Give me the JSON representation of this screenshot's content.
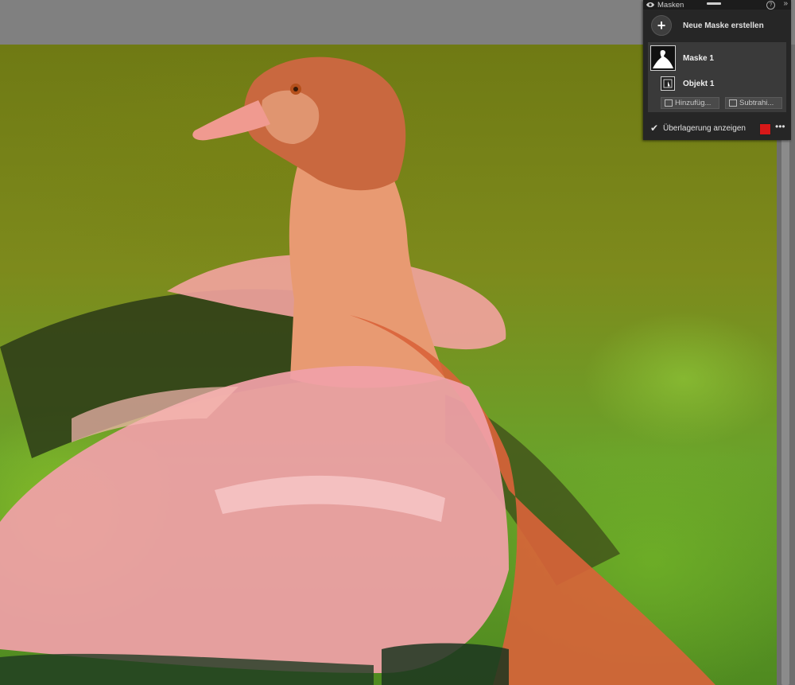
{
  "panel": {
    "title": "Masken",
    "new_mask_label": "Neue Maske erstellen",
    "mask_name": "Maske 1",
    "object_name": "Objekt 1",
    "add_button": "Hinzufüg...",
    "subtract_button": "Subtrahi...",
    "overlay_label": "Überlagerung anzeigen",
    "overlay_checked": true,
    "overlay_color": "#d81818",
    "icons": {
      "eye": "eye-icon",
      "help": "help-icon",
      "collapse": "double-chevron-right-icon",
      "plus": "plus-icon",
      "more": "more-icon",
      "check": "checkmark-icon"
    }
  },
  "colors": {
    "canvas_bg": "#808080",
    "panel_bg": "#262626",
    "mask_overlay": "#ff6f6f"
  }
}
